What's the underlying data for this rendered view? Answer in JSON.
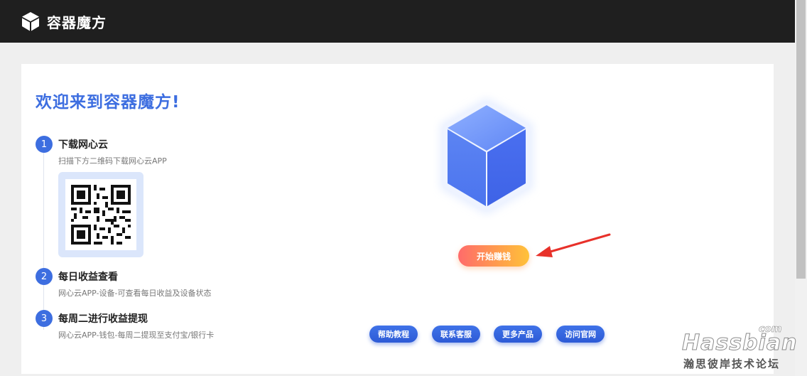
{
  "header": {
    "title": "容器魔方",
    "logo_icon": "cube-logo-icon"
  },
  "main": {
    "welcome": "欢迎来到容器魔方!",
    "steps": [
      {
        "num": "1",
        "title": "下载网心云",
        "desc": "扫描下方二维码下载网心云APP"
      },
      {
        "num": "2",
        "title": "每日收益查看",
        "desc": "网心云APP-设备-可查看每日收益及设备状态"
      },
      {
        "num": "3",
        "title": "每周二进行收益提现",
        "desc": "网心云APP-钱包-每周二提现至支付宝/银行卡"
      }
    ],
    "start_button": "开始赚钱",
    "links": [
      "帮助教程",
      "联系客服",
      "更多产品",
      "访问官网"
    ]
  },
  "watermark": {
    "brand": "Hassbian",
    "suffix": "com",
    "cn": "瀚思彼岸技术论坛"
  },
  "colors": {
    "accent": "#3d6ee0",
    "header_bg": "#1f1f1f",
    "start_gradient": [
      "#ff6b6b",
      "#ffc23a"
    ],
    "arrow": "#e8312a"
  }
}
